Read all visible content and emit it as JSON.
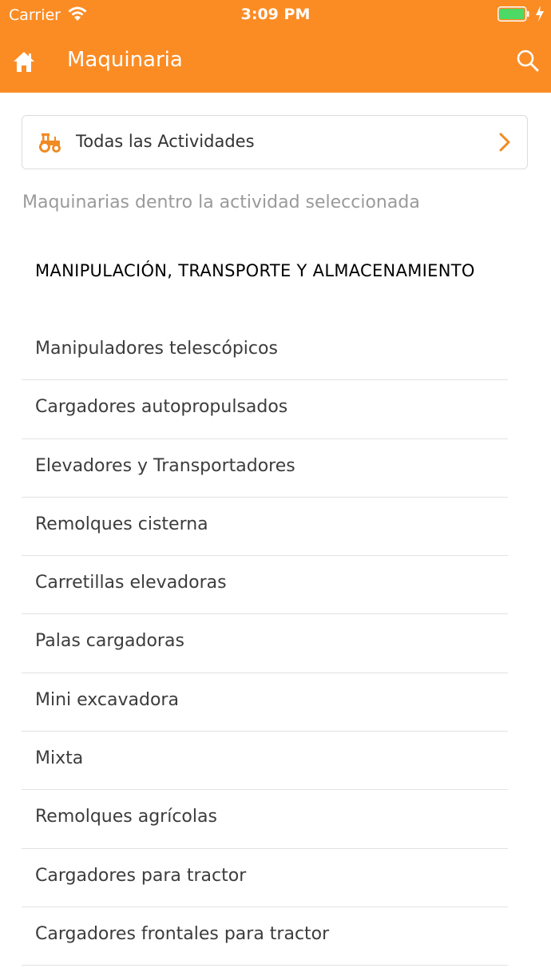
{
  "status_bar": {
    "carrier": "Carrier",
    "time": "3:09 PM"
  },
  "navbar": {
    "title": "Maquinaria",
    "home_icon": "home-icon",
    "search_icon": "search-icon"
  },
  "filter": {
    "label": "Todas las Actividades",
    "icon": "tractor-icon"
  },
  "section_caption": "Maquinarias dentro la actividad seleccionada",
  "category": {
    "title": "MANIPULACIÓN, TRANSPORTE Y ALMACENAMIENTO"
  },
  "items": [
    {
      "label": "Manipuladores telescópicos"
    },
    {
      "label": "Cargadores autopropulsados"
    },
    {
      "label": "Elevadores y Transportadores"
    },
    {
      "label": "Remolques cisterna"
    },
    {
      "label": "Carretillas elevadoras"
    },
    {
      "label": "Palas cargadoras"
    },
    {
      "label": "Mini excavadora"
    },
    {
      "label": "Mixta"
    },
    {
      "label": "Remolques agrícolas"
    },
    {
      "label": "Cargadores para tractor"
    },
    {
      "label": "Cargadores frontales para tractor"
    }
  ],
  "colors": {
    "accent": "#fb8c24",
    "battery": "#4cd964"
  }
}
